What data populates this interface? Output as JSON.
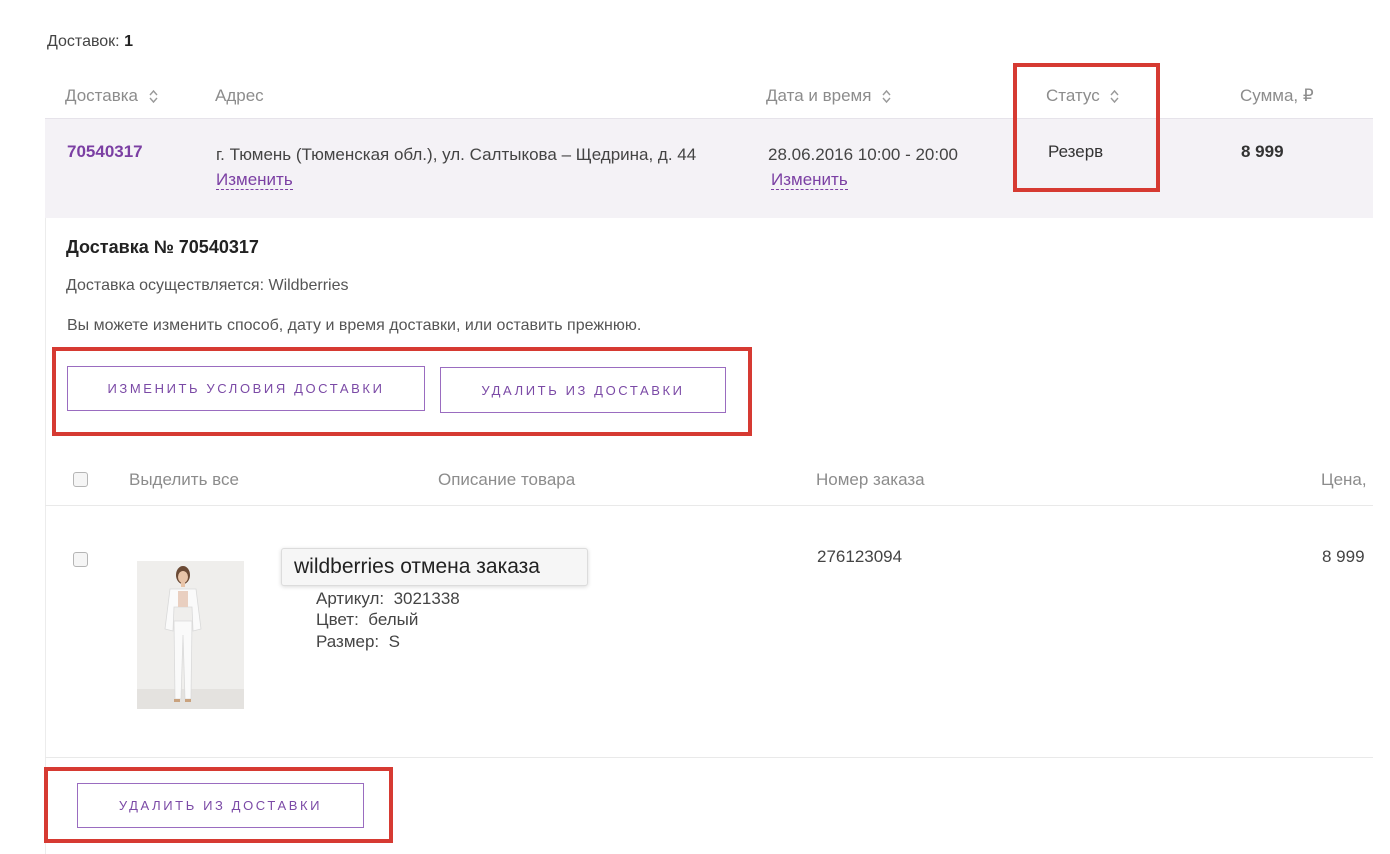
{
  "summary": {
    "label": "Доставок:",
    "count": "1"
  },
  "table_header": {
    "delivery": "Доставка",
    "address": "Адрес",
    "datetime": "Дата и время",
    "status": "Статус",
    "sum": "Сумма, ₽"
  },
  "delivery_row": {
    "id": "70540317",
    "address": "г. Тюмень (Тюменская обл.), ул. Салтыкова – Щедрина, д. 44",
    "address_change": "Изменить",
    "datetime": "28.06.2016 10:00 - 20:00",
    "datetime_change": "Изменить",
    "status": "Резерв",
    "sum": "8 999"
  },
  "details": {
    "title": "Доставка № 70540317",
    "carrier": "Доставка осуществляется: Wildberries",
    "note": "Вы можете изменить способ, дату и время доставки, или оставить прежнюю.",
    "change_button": "изменить условия доставки",
    "remove_button": "удалить из доставки"
  },
  "items_header": {
    "select_all": "Выделить все",
    "description": "Описание товара",
    "order_number": "Номер заказа",
    "price": "Цена,"
  },
  "item": {
    "tooltip": "wildberries отмена заказа",
    "article_label": "Артикул:",
    "article": "3021338",
    "color_label": "Цвет:",
    "color": "белый",
    "size_label": "Размер:",
    "size": "S",
    "order_number": "276123094",
    "price": "8 999"
  },
  "footer": {
    "remove_button": "удалить из доставки"
  },
  "colors": {
    "accent": "#7b3fa3",
    "highlight": "#d63a32",
    "row_bg": "#f4f2f6"
  }
}
